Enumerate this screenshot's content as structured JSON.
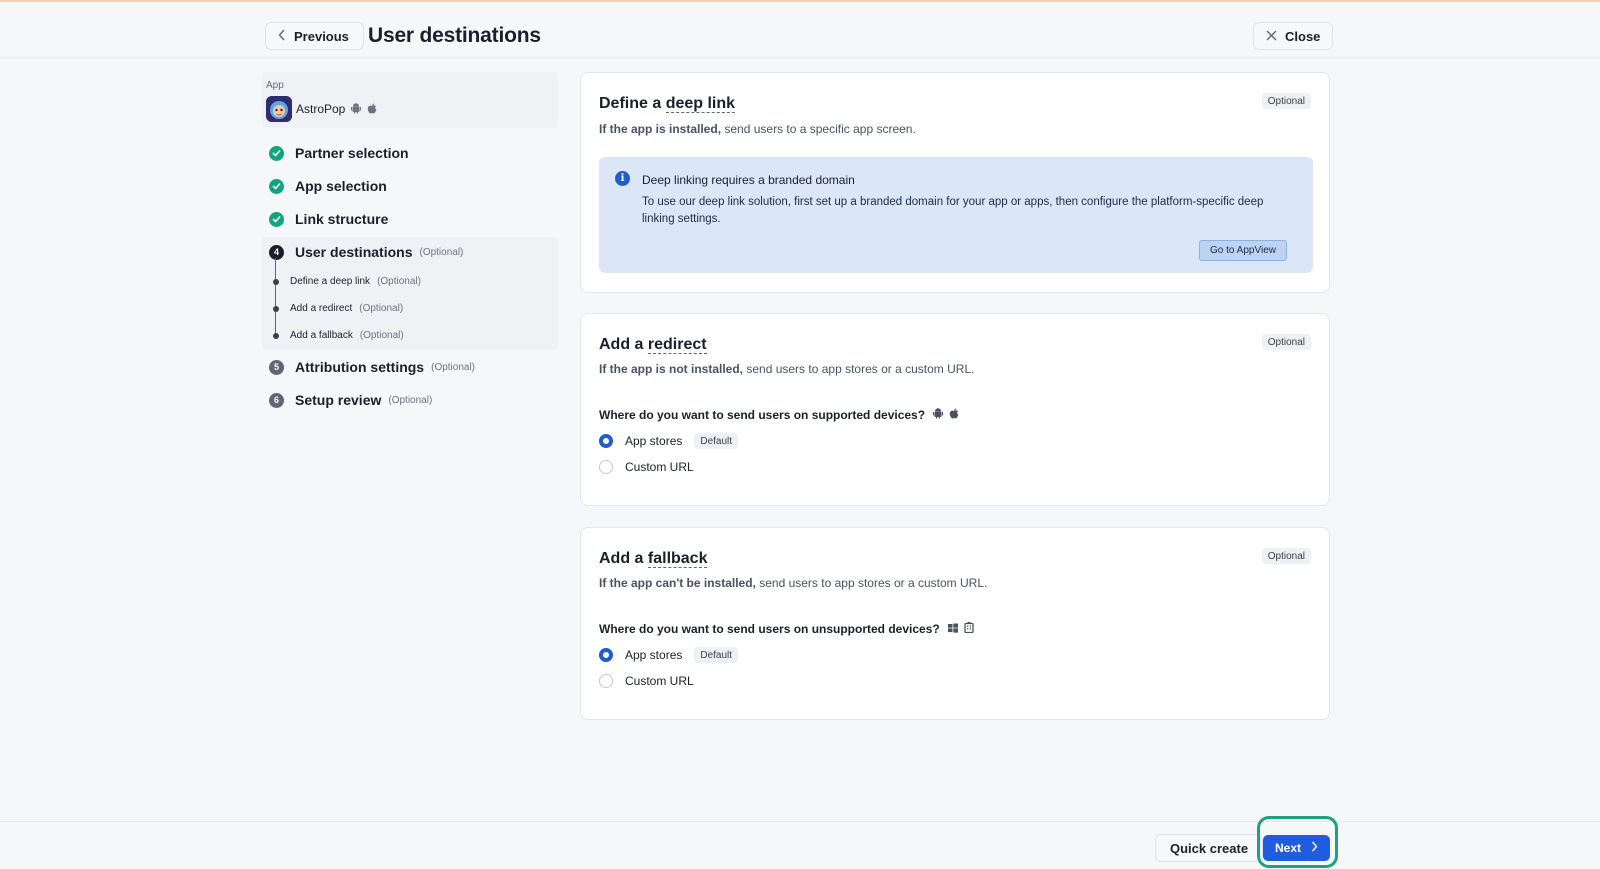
{
  "header": {
    "previous_label": "Previous",
    "title": "User destinations",
    "close_label": "Close"
  },
  "sidebar": {
    "app_label": "App",
    "app_name": "AstroPop",
    "app_platform_icons": [
      "android-icon",
      "apple-icon"
    ],
    "steps": [
      {
        "number": "1",
        "label": "Partner selection",
        "optional": "",
        "status": "done"
      },
      {
        "number": "2",
        "label": "App selection",
        "optional": "",
        "status": "done"
      },
      {
        "number": "3",
        "label": "Link structure",
        "optional": "",
        "status": "done"
      },
      {
        "number": "4",
        "label": "User destinations",
        "optional": "(Optional)",
        "status": "active"
      },
      {
        "number": "5",
        "label": "Attribution settings",
        "optional": "(Optional)",
        "status": "todo"
      },
      {
        "number": "6",
        "label": "Setup review",
        "optional": "(Optional)",
        "status": "todo"
      }
    ],
    "substeps": [
      {
        "label": "Define a deep link",
        "optional": "(Optional)"
      },
      {
        "label": "Add a redirect",
        "optional": "(Optional)"
      },
      {
        "label": "Add a fallback",
        "optional": "(Optional)"
      }
    ]
  },
  "cards": {
    "deep_link": {
      "title_prefix": "Define a ",
      "title_term": "deep link",
      "badge": "Optional",
      "sub_bold": "If the app is installed,",
      "sub_rest": " send users to a specific app screen.",
      "info_title": "Deep linking requires a branded domain",
      "info_body": "To use our deep link solution, first set up a branded domain for your app or apps, then configure the platform-specific deep linking settings.",
      "info_button": "Go to AppView"
    },
    "redirect": {
      "title_prefix": "Add a ",
      "title_term": "redirect",
      "badge": "Optional",
      "sub_bold": "If the app is not installed,",
      "sub_rest": " send users to app stores or a custom URL.",
      "question": "Where do you want to send users on supported devices?",
      "option_1": "App stores",
      "option_1_badge": "Default",
      "option_2": "Custom URL",
      "selected": "App stores"
    },
    "fallback": {
      "title_prefix": "Add a ",
      "title_term": "fallback",
      "badge": "Optional",
      "sub_bold": "If the app can't be installed,",
      "sub_rest": " send users to app stores or a custom URL.",
      "question": "Where do you want to send users on unsupported devices?",
      "option_1": "App stores",
      "option_1_badge": "Default",
      "option_2": "Custom URL",
      "selected": "App stores"
    }
  },
  "footer": {
    "quick_create_label": "Quick create",
    "next_label": "Next"
  },
  "colors": {
    "accent": "#1f5ce0",
    "success": "#14a37f",
    "highlight": "#1ea27a",
    "info_bg": "#dbe7f6"
  }
}
